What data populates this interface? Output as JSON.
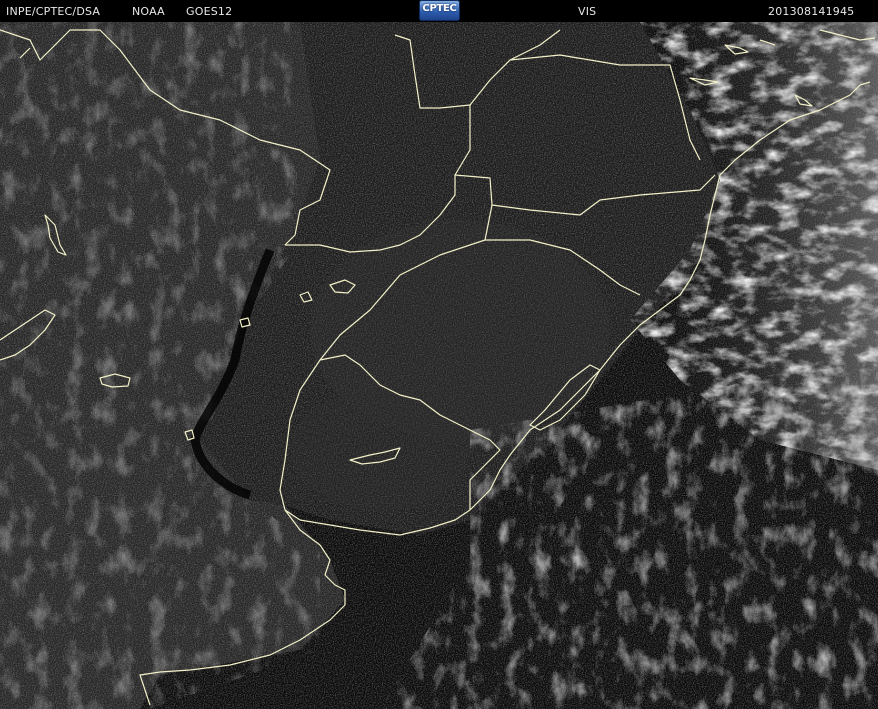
{
  "header": {
    "source": "INPE/CPTEC/DSA",
    "agency": "NOAA",
    "satellite": "GOES12",
    "channel": "VIS",
    "timestamp": "201308141945",
    "logo_text": "CPTEC"
  },
  "colors": {
    "background": "#000000",
    "header_text": "#e8e8e8",
    "border_lines": "#f2f0c8",
    "cloud_bright": "#cfcfcf",
    "land_dark": "#2a2a2a",
    "ocean": "#050505",
    "logo_blue": "#2e5fb0"
  },
  "icons": {
    "logo": "cptec-logo"
  }
}
